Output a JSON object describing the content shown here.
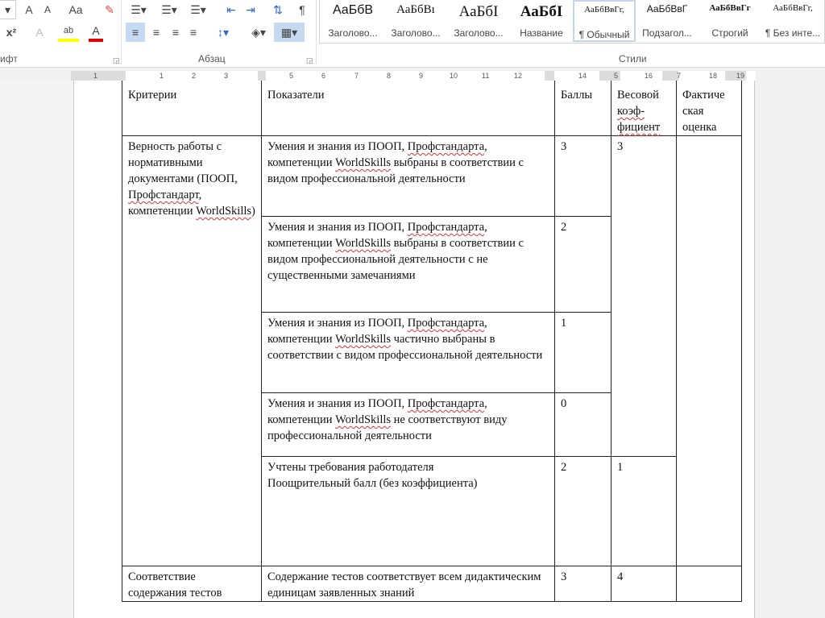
{
  "ribbon": {
    "font_group_label": "ифт",
    "paragraph_group_label": "Абзац",
    "styles_group_label": "Стили",
    "font_buttons": {
      "grow": "A",
      "shrink": "A",
      "case": "Aa",
      "superscript": "x²",
      "text_effects": "A",
      "highlight": "ab",
      "font_color": "A"
    },
    "highlight_color": "#ffff00",
    "font_color": "#e00000",
    "styles": [
      {
        "preview": "АаБбВ",
        "name": "Заголово..."
      },
      {
        "preview": "АаБбВı",
        "name": "Заголово..."
      },
      {
        "preview": "АаБбI",
        "name": "Заголово..."
      },
      {
        "preview": "АаБбI",
        "name": "Название"
      },
      {
        "preview": "АаБбВвГг,",
        "name": "¶ Обычный"
      },
      {
        "preview": "АаБбВвГ",
        "name": "Подзагол..."
      },
      {
        "preview": "АаБбВвГг",
        "name": "Строгий"
      },
      {
        "preview": "АаБбВвГг,",
        "name": "¶ Без инте..."
      }
    ]
  },
  "ruler": {
    "numbers": [
      "1",
      "1",
      "2",
      "3",
      "5",
      "6",
      "7",
      "8",
      "9",
      "10",
      "11",
      "12",
      "14",
      "5",
      "16",
      "7",
      "18",
      "19"
    ]
  },
  "table": {
    "headers": [
      "Критерии",
      "Показатели",
      "Баллы",
      "Весовой коэф-фициент",
      "Фактическая оценка"
    ],
    "header_parts": {
      "weight1": "Весовой",
      "weight2": "коэф-",
      "weight3": "фициент",
      "fact1": "Фактиче",
      "fact2": "ская",
      "fact3": "оценка"
    },
    "criterion1": {
      "a": "Верность работы с нормативными документами (ПООП, ",
      "b": "Профстандарт",
      "c": ", компетенции ",
      "d": "WorldSkills",
      "e": ")"
    },
    "rows": [
      {
        "a": "Умения и знания из ПООП, ",
        "b": "Профстандарта",
        "c": ", компетенции ",
        "d": "WorldSkills",
        "e": " выбраны в соответствии с видом профессиональной деятельности",
        "score": "3"
      },
      {
        "a": "Умения и знания из ПООП, ",
        "b": "Профстандарта",
        "c": ", компетенции ",
        "d": "WorldSkills",
        "e": " выбраны в соответствии с видом профессиональной деятельности с не существенными замечаниями",
        "score": "2"
      },
      {
        "a": "Умения и знания из ПООП, ",
        "b": "Профстандарта",
        "c": ", компетенции ",
        "d": "WorldSkills",
        "e": " частично выбраны в соответствии с видом профессиональной деятельности",
        "score": "1"
      },
      {
        "a": "Умения и знания из ПООП, ",
        "b": "Профстандарта",
        "c": ", компетенции ",
        "d": "WorldSkills",
        "e": " не соответствуют виду профессиональной деятельности",
        "score": "0"
      }
    ],
    "weight1": "3",
    "employer": {
      "line1": "Учтены требования работодателя",
      "line2": "Поощрительный балл (без коэффициента)",
      "score": "2",
      "weight": "1"
    },
    "criterion2": {
      "text": "Соответствие содержания тестов",
      "indicator": "Содержание тестов соответствует всем дидактическим единицам заявленных знаний",
      "score": "3",
      "weight": "4"
    }
  }
}
